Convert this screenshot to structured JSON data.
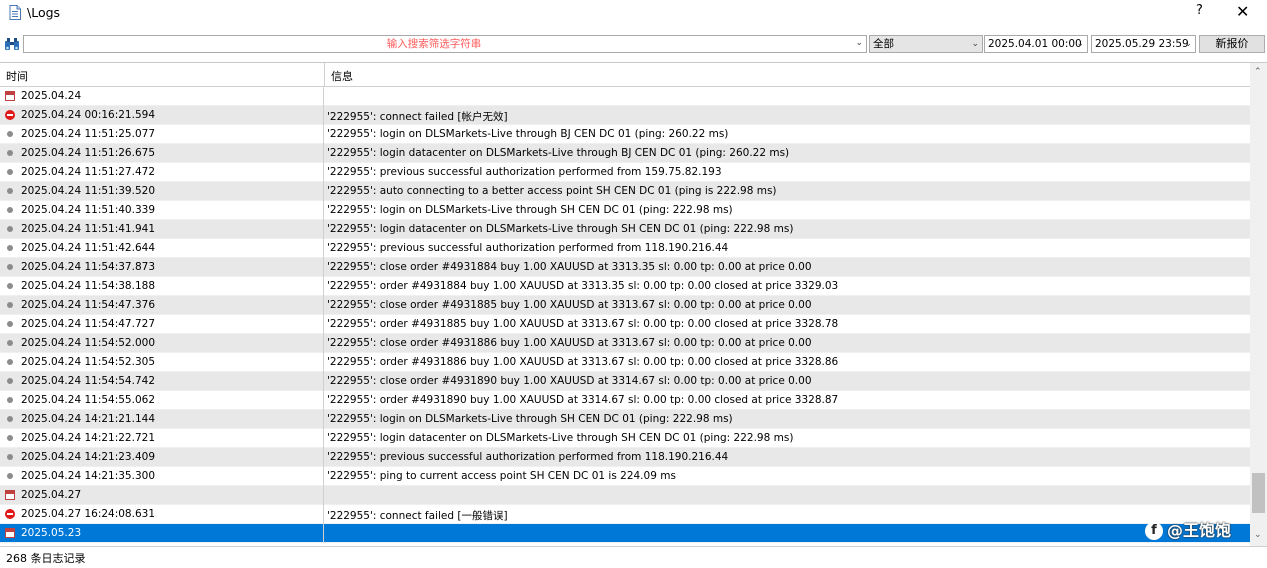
{
  "window": {
    "title": "\\Logs",
    "help_label": "?",
    "close_label": "✕"
  },
  "toolbar": {
    "search_placeholder": "输入搜索筛选字符串",
    "source_filter": "全部",
    "date_from": "2025.04.01 00:00",
    "date_to": "2025.05.29 23:59",
    "request_button": "新报价"
  },
  "table": {
    "columns": [
      "时间",
      "信息"
    ],
    "rows": [
      {
        "icon": "calendar-icon",
        "time": "2025.04.24",
        "message": ""
      },
      {
        "icon": "error-icon",
        "time": "2025.04.24 00:16:21.594",
        "message": "'222955': connect failed [帐户无效]"
      },
      {
        "icon": "info-dot-icon",
        "time": "2025.04.24 11:51:25.077",
        "message": "'222955': login on DLSMarkets-Live through BJ CEN DC 01 (ping: 260.22 ms)"
      },
      {
        "icon": "info-dot-icon",
        "time": "2025.04.24 11:51:26.675",
        "message": "'222955': login datacenter on DLSMarkets-Live through BJ CEN DC 01 (ping: 260.22 ms)"
      },
      {
        "icon": "info-dot-icon",
        "time": "2025.04.24 11:51:27.472",
        "message": "'222955': previous successful authorization performed from 159.75.82.193"
      },
      {
        "icon": "info-dot-icon",
        "time": "2025.04.24 11:51:39.520",
        "message": "'222955': auto connecting to a better access point SH CEN DC 01 (ping is 222.98 ms)"
      },
      {
        "icon": "info-dot-icon",
        "time": "2025.04.24 11:51:40.339",
        "message": "'222955': login on DLSMarkets-Live through SH CEN DC 01 (ping: 222.98 ms)"
      },
      {
        "icon": "info-dot-icon",
        "time": "2025.04.24 11:51:41.941",
        "message": "'222955': login datacenter on DLSMarkets-Live through SH CEN DC 01 (ping: 222.98 ms)"
      },
      {
        "icon": "info-dot-icon",
        "time": "2025.04.24 11:51:42.644",
        "message": "'222955': previous successful authorization performed from 118.190.216.44"
      },
      {
        "icon": "info-dot-icon",
        "time": "2025.04.24 11:54:37.873",
        "message": "'222955': close order #4931884 buy 1.00 XAUUSD at 3313.35 sl: 0.00 tp: 0.00 at price 0.00"
      },
      {
        "icon": "info-dot-icon",
        "time": "2025.04.24 11:54:38.188",
        "message": "'222955': order #4931884 buy 1.00 XAUUSD at 3313.35 sl: 0.00 tp: 0.00 closed at price 3329.03"
      },
      {
        "icon": "info-dot-icon",
        "time": "2025.04.24 11:54:47.376",
        "message": "'222955': close order #4931885 buy 1.00 XAUUSD at 3313.67 sl: 0.00 tp: 0.00 at price 0.00"
      },
      {
        "icon": "info-dot-icon",
        "time": "2025.04.24 11:54:47.727",
        "message": "'222955': order #4931885 buy 1.00 XAUUSD at 3313.67 sl: 0.00 tp: 0.00 closed at price 3328.78"
      },
      {
        "icon": "info-dot-icon",
        "time": "2025.04.24 11:54:52.000",
        "message": "'222955': close order #4931886 buy 1.00 XAUUSD at 3313.67 sl: 0.00 tp: 0.00 at price 0.00"
      },
      {
        "icon": "info-dot-icon",
        "time": "2025.04.24 11:54:52.305",
        "message": "'222955': order #4931886 buy 1.00 XAUUSD at 3313.67 sl: 0.00 tp: 0.00 closed at price 3328.86"
      },
      {
        "icon": "info-dot-icon",
        "time": "2025.04.24 11:54:54.742",
        "message": "'222955': close order #4931890 buy 1.00 XAUUSD at 3314.67 sl: 0.00 tp: 0.00 at price 0.00"
      },
      {
        "icon": "info-dot-icon",
        "time": "2025.04.24 11:54:55.062",
        "message": "'222955': order #4931890 buy 1.00 XAUUSD at 3314.67 sl: 0.00 tp: 0.00 closed at price 3328.87"
      },
      {
        "icon": "info-dot-icon",
        "time": "2025.04.24 14:21:21.144",
        "message": "'222955': login on DLSMarkets-Live through SH CEN DC 01 (ping: 222.98 ms)"
      },
      {
        "icon": "info-dot-icon",
        "time": "2025.04.24 14:21:22.721",
        "message": "'222955': login datacenter on DLSMarkets-Live through SH CEN DC 01 (ping: 222.98 ms)"
      },
      {
        "icon": "info-dot-icon",
        "time": "2025.04.24 14:21:23.409",
        "message": "'222955': previous successful authorization performed from 118.190.216.44"
      },
      {
        "icon": "info-dot-icon",
        "time": "2025.04.24 14:21:35.300",
        "message": "'222955': ping to current access point SH CEN DC 01 is 224.09 ms"
      },
      {
        "icon": "calendar-icon",
        "time": "2025.04.27",
        "message": ""
      },
      {
        "icon": "error-icon",
        "time": "2025.04.27 16:24:08.631",
        "message": "'222955': connect failed [一般错误]"
      },
      {
        "icon": "calendar-icon",
        "time": "2025.05.23",
        "message": "",
        "selected": true
      }
    ]
  },
  "status": {
    "record_count": "268 条日志记录"
  },
  "watermark": {
    "text": "@王饱饱",
    "logo_glyph": "f"
  }
}
